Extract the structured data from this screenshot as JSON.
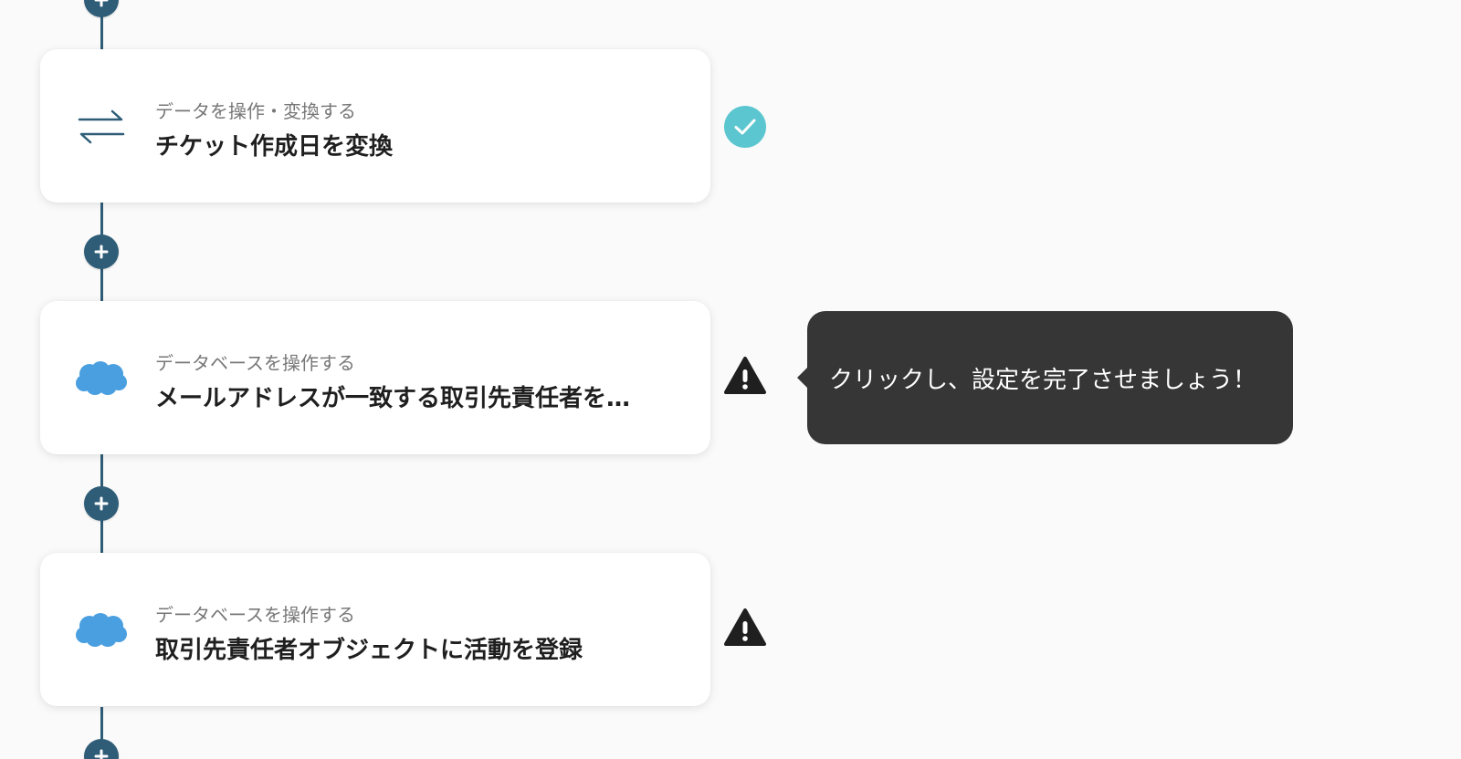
{
  "steps": [
    {
      "category": "データを操作・変換する",
      "title": "チケット作成日を変換",
      "icon": "convert-arrows-icon",
      "status": "complete",
      "status_icon": "check-circle-icon"
    },
    {
      "category": "データベースを操作する",
      "title": "メールアドレスが一致する取引先責任者を…",
      "icon": "salesforce-cloud-icon",
      "status": "warning",
      "status_icon": "warning-triangle-icon"
    },
    {
      "category": "データベースを操作する",
      "title": "取引先責任者オブジェクトに活動を登録",
      "icon": "salesforce-cloud-icon",
      "status": "warning",
      "status_icon": "warning-triangle-icon"
    }
  ],
  "tooltip": {
    "text": "クリックし、設定を完了させましょう！"
  },
  "colors": {
    "background": "#fafafa",
    "connector": "#2f5d78",
    "check": "#5cc6d0",
    "salesforce": "#4a9fe0",
    "warning": "#1f1f1f",
    "tooltip_bg": "#363636"
  }
}
